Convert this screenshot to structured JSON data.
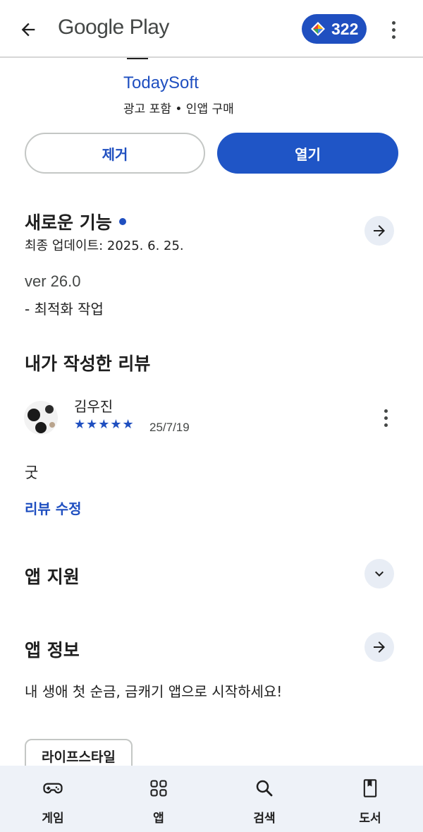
{
  "header": {
    "title": "Google Play",
    "points": "322"
  },
  "app": {
    "developer": "TodaySoft",
    "meta": "광고 포함 • 인앱 구매",
    "uninstall_label": "제거",
    "open_label": "열기"
  },
  "whats_new": {
    "title": "새로운 기능",
    "updated": "최종 업데이트: 2025. 6. 25.",
    "version": "ver 26.0",
    "note": "- 최적화 작업"
  },
  "my_review": {
    "title": "내가 작성한 리뷰",
    "reviewer": "김우진",
    "stars": "★★★★★",
    "rating": 5,
    "date": "25/7/19",
    "text": "굿",
    "edit_label": "리뷰 수정"
  },
  "app_support": {
    "title": "앱 지원"
  },
  "app_info": {
    "title": "앱 정보",
    "description": "내 생애 첫 순금, 금캐기 앱으로 시작하세요!",
    "category": "라이프스타일"
  },
  "bottom_nav": {
    "items": [
      {
        "label": "게임",
        "icon": "gamepad-icon"
      },
      {
        "label": "앱",
        "icon": "apps-grid-icon"
      },
      {
        "label": "검색",
        "icon": "search-icon"
      },
      {
        "label": "도서",
        "icon": "book-icon"
      }
    ]
  },
  "colors": {
    "accent": "#1f4fc0",
    "primary_button": "#1f55c6",
    "nav_background": "#eef2f8"
  }
}
